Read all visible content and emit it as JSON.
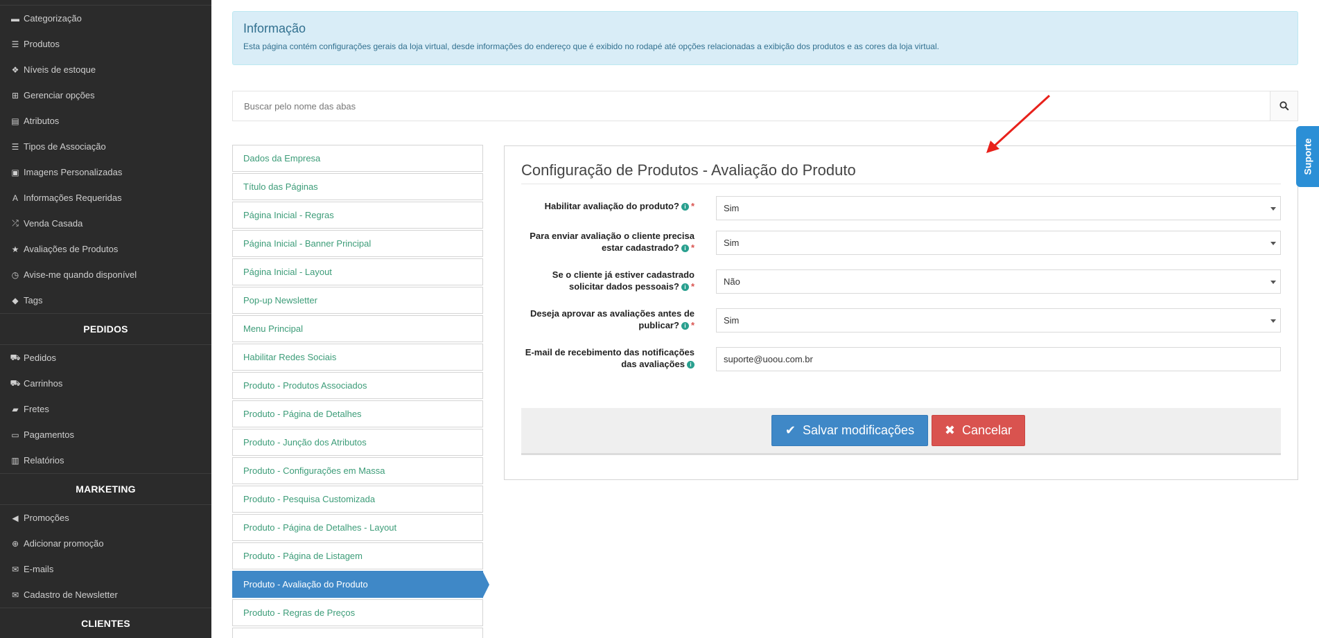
{
  "sidebar": {
    "items_top": [
      {
        "icon": "folder-icon",
        "label": "Categorização"
      },
      {
        "icon": "list-icon",
        "label": "Produtos"
      },
      {
        "icon": "cubes-icon",
        "label": "Níveis de estoque"
      },
      {
        "icon": "grid-icon",
        "label": "Gerenciar opções"
      },
      {
        "icon": "list-alt-icon",
        "label": "Atributos"
      },
      {
        "icon": "list-icon",
        "label": "Tipos de Associação"
      },
      {
        "icon": "image-icon",
        "label": "Imagens Personalizadas"
      },
      {
        "icon": "font-icon",
        "label": "Informações Requeridas"
      },
      {
        "icon": "shuffle-icon",
        "label": "Venda Casada"
      },
      {
        "icon": "star-icon",
        "label": "Avaliações de Produtos"
      },
      {
        "icon": "clock-icon",
        "label": "Avise-me quando disponível"
      },
      {
        "icon": "tag-icon",
        "label": "Tags"
      }
    ],
    "section_pedidos": "PEDIDOS",
    "items_pedidos": [
      {
        "icon": "cart-icon",
        "label": "Pedidos"
      },
      {
        "icon": "cart-icon",
        "label": "Carrinhos"
      },
      {
        "icon": "truck-icon",
        "label": "Fretes"
      },
      {
        "icon": "credit-card-icon",
        "label": "Pagamentos"
      },
      {
        "icon": "bar-chart-icon",
        "label": "Relatórios"
      }
    ],
    "section_marketing": "MARKETING",
    "items_marketing": [
      {
        "icon": "bullhorn-icon",
        "label": "Promoções"
      },
      {
        "icon": "plus-circle-icon",
        "label": "Adicionar promoção"
      },
      {
        "icon": "envelope-icon",
        "label": "E-mails"
      },
      {
        "icon": "envelope-icon",
        "label": "Cadastro de Newsletter"
      }
    ],
    "section_clientes": "CLIENTES"
  },
  "info": {
    "title": "Informação",
    "text": "Esta página contém configurações gerais da loja virtual, desde informações do endereço que é exibido no rodapé até opções relacionadas a exibição dos produtos e as cores da loja virtual."
  },
  "search": {
    "placeholder": "Buscar pelo nome das abas"
  },
  "tabs": [
    "Dados da Empresa",
    "Título das Páginas",
    "Página Inicial - Regras",
    "Página Inicial - Banner Principal",
    "Página Inicial - Layout",
    "Pop-up Newsletter",
    "Menu Principal",
    "Habilitar Redes Sociais",
    "Produto - Produtos Associados",
    "Produto - Página de Detalhes",
    "Produto - Junção dos Atributos",
    "Produto - Configurações em Massa",
    "Produto - Pesquisa Customizada",
    "Produto - Página de Detalhes - Layout",
    "Produto - Página de Listagem",
    "Produto - Avaliação do Produto",
    "Produto - Regras de Preços"
  ],
  "active_tab": "Produto - Avaliação do Produto",
  "form": {
    "title": "Configuração de Produtos - Avaliação do Produto",
    "fields": [
      {
        "label_1": "Habilitar avaliação do produto?",
        "label_2": "",
        "value": "Sim",
        "required": true
      },
      {
        "label_1": "Para enviar avaliação o cliente precisa",
        "label_2": "estar cadastrado?",
        "value": "Sim",
        "required": true
      },
      {
        "label_1": "Se o cliente já estiver cadastrado",
        "label_2": "solicitar dados pessoais?",
        "value": "Não",
        "required": true
      },
      {
        "label_1": "Deseja aprovar as avaliações antes de",
        "label_2": "publicar?",
        "value": "Sim",
        "required": true
      },
      {
        "label_1": "E-mail de recebimento das notificações",
        "label_2": "das avaliações",
        "value": "suporte@uoou.com.br",
        "required": false
      }
    ],
    "save_label": "Salvar modificações",
    "cancel_label": "Cancelar"
  },
  "support_tab": "Suporte",
  "colors": {
    "sidebar_bg": "#2b2b2b",
    "primary": "#3f88c7",
    "danger": "#d9534f",
    "tab_link": "#3c9c78",
    "info_bg": "#d9edf7",
    "arrow": "#e8211b"
  }
}
